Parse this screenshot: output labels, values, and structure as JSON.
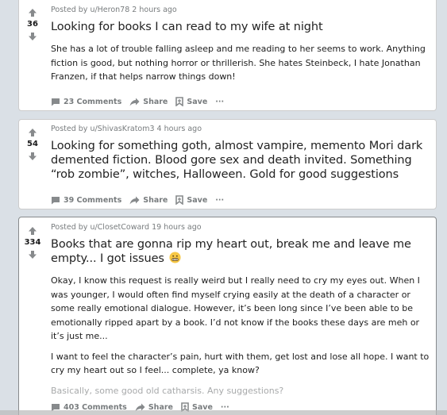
{
  "colors": {
    "page_background": "#dae0e6",
    "card_background": "#ffffff",
    "meta_text": "#787c7e",
    "title_text": "#222222",
    "vote_arrow": "#878a8c"
  },
  "posts": [
    {
      "score": "36",
      "meta": "Posted by u/Heron78 2 hours ago",
      "title": "Looking for books I can read to my wife at night",
      "body": [
        "She has a lot of trouble falling asleep and me reading to her seems to work. Anything fiction is good, but nothing horror or thrillerish. She hates Steinbeck, I hate Jonathan Franzen, if that helps narrow things down!"
      ],
      "comments": "23 Comments",
      "share": "Share",
      "save": "Save",
      "more": "···"
    },
    {
      "score": "54",
      "meta": "Posted by u/ShivasKratom3 4 hours ago",
      "title": "Looking for something goth, almost vampire, memento Mori dark demented fiction. Blood gore sex and death invited. Something “rob zombie”, witches, Halloween. Gold for good suggestions",
      "body": [],
      "comments": "39 Comments",
      "share": "Share",
      "save": "Save",
      "more": "···"
    },
    {
      "score": "334",
      "meta": "Posted by u/ClosetCoward 19 hours ago",
      "title": "Books that are gonna rip my heart out, break me and leave me empty... I got issues",
      "title_emoji": "grimacing-face-emoji",
      "body": [
        "Okay, I know this request is really weird but I really need to cry my eyes out. When I was younger, I would often find myself crying easily at the death of a character or some really emotional dialogue. However, it’s been long since I’ve been able to be emotionally ripped apart by a book. I’d not know if the books these days are meh or it’s just me...",
        "I want to feel the character’s pain, hurt with them, get lost and lose all hope. I want to cry my heart out so I feel... complete, ya know?",
        "Basically, some good old catharsis. Any suggestions?"
      ],
      "comments": "403 Comments",
      "share": "Share",
      "save": "Save",
      "more": "···"
    }
  ]
}
